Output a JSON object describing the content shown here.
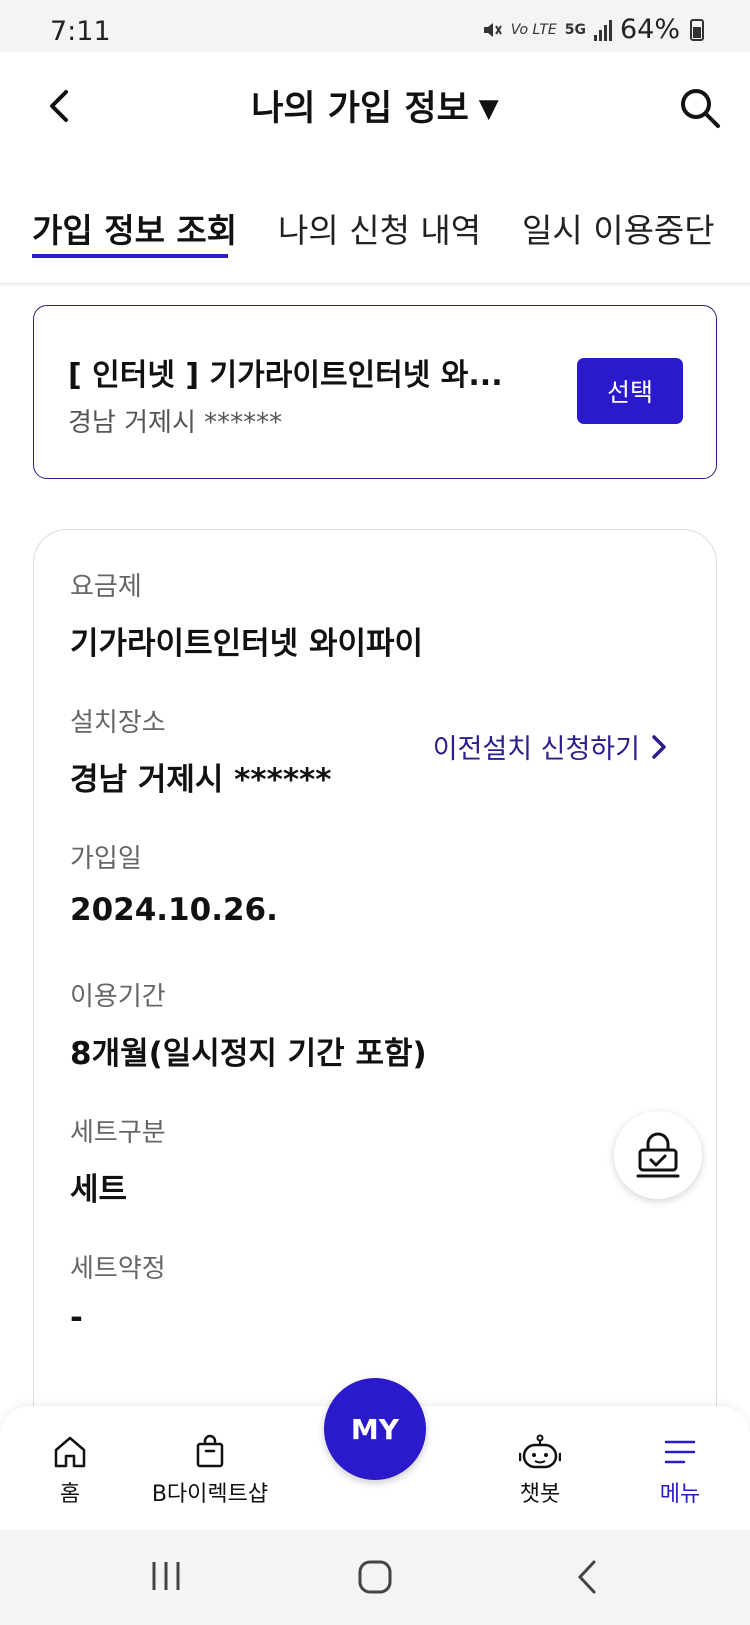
{
  "status_bar": {
    "time": "7:11",
    "network_label": "Vo LTE",
    "network_type": "5G",
    "battery": "64%"
  },
  "header": {
    "title": "나의 가입 정보",
    "title_caret": "▼"
  },
  "tabs": [
    {
      "label": "가입 정보 조회",
      "active": true
    },
    {
      "label": "나의 신청 내역",
      "active": false
    },
    {
      "label": "일시 이용중단",
      "active": false
    }
  ],
  "service_card": {
    "name": "[ 인터넷 ] 기가라이트인터넷 와...",
    "address": "경남 거제시 ******",
    "select_label": "선택"
  },
  "details": {
    "plan_label": "요금제",
    "plan_value": "기가라이트인터넷 와이파이",
    "location_label": "설치장소",
    "location_value": "경남 거제시 ******",
    "transfer_link": "이전설치 신청하기",
    "join_date_label": "가입일",
    "join_date_value": "2024.10.26.",
    "period_label": "이용기간",
    "period_value": "8개월(일시정지 기간 포함)",
    "set_type_label": "세트구분",
    "set_type_value": "세트",
    "set_contract_label": "세트약정",
    "set_contract_value": "-"
  },
  "bottom_nav": {
    "home": "홈",
    "shop": "B다이렉트샵",
    "my": "MY",
    "chatbot": "챗봇",
    "menu": "메뉴"
  },
  "colors": {
    "accent": "#2a1acc",
    "link": "#2a1f8a"
  }
}
